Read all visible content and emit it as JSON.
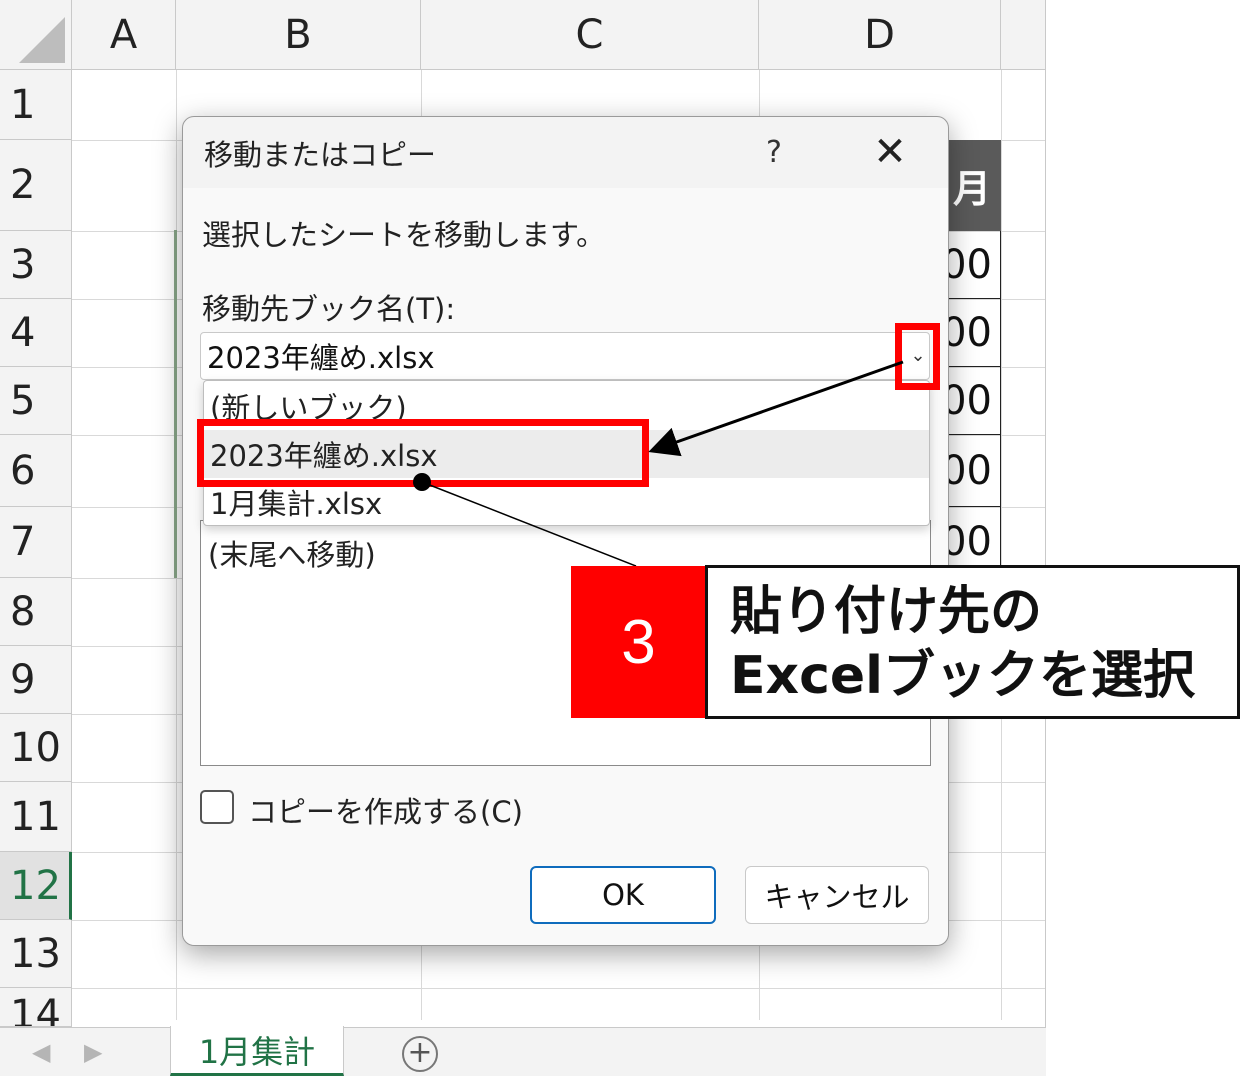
{
  "sheet": {
    "columns": [
      "A",
      "B",
      "C",
      "D"
    ],
    "rows": [
      "1",
      "2",
      "3",
      "4",
      "5",
      "6",
      "7",
      "8",
      "9",
      "10",
      "11",
      "12",
      "13",
      "14"
    ],
    "selected_row": "12",
    "table_header": "月",
    "table_values": [
      "00",
      "00",
      "00",
      "00",
      "00"
    ],
    "sheet_tab": "1月集計",
    "add_sheet_symbol": "+",
    "nav_prev": "◀",
    "nav_next": "▶"
  },
  "dialog": {
    "title": "移動またはコピー",
    "help": "?",
    "close": "✕",
    "description": "選択したシートを移動します。",
    "book_label": "移動先ブック名(T):",
    "book_value": "2023年纏め.xlsx",
    "dropdown_items": [
      "(新しいブック)",
      "2023年纏め.xlsx",
      "1月集計.xlsx"
    ],
    "list_first_item": "(末尾へ移動)",
    "copy_label": "コピーを作成する(C)",
    "ok": "OK",
    "cancel": "キャンセル"
  },
  "annotation": {
    "step": "3",
    "line1": "貼り付け先の",
    "line2": "Excelブックを選択",
    "highlight_color": "#ff0000"
  }
}
